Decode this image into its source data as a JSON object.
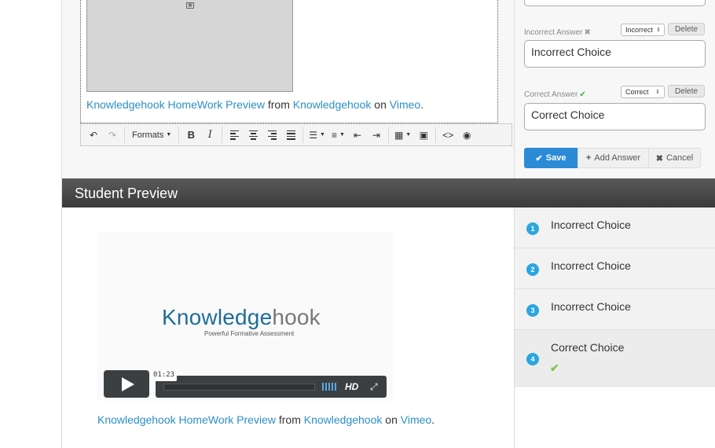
{
  "editor": {
    "placeholder_icon": "video-placeholder-icon",
    "credit": {
      "title": "Knowledgehook HomeWork Preview",
      "from": "from",
      "author": "Knowledgehook",
      "on": "on",
      "site": "Vimeo",
      "period": "."
    },
    "toolbar": {
      "undo": "↶",
      "redo": "↷",
      "formats": "Formats",
      "bold": "B",
      "italic": "I",
      "code": "<>",
      "preview": "◉"
    }
  },
  "answers": {
    "incorrect": {
      "label": "Incorrect Answer",
      "select": "Incorrect",
      "delete": "Delete",
      "value": "Incorrect Choice"
    },
    "correct": {
      "label": "Correct Answer",
      "select": "Correct",
      "delete": "Delete",
      "value": "Correct Choice"
    },
    "buttons": {
      "save": "Save",
      "add": "Add Answer",
      "cancel": "Cancel"
    }
  },
  "preview": {
    "header": "Student Preview",
    "video": {
      "brand_main": "Knowledge",
      "brand_light": "hook",
      "brand_sub": "Powerful Formative Assessment",
      "time": "01:23",
      "hd": "HD"
    },
    "credit": {
      "title": "Knowledgehook HomeWork Preview",
      "from": "from",
      "author": "Knowledgehook",
      "on": "on",
      "site": "Vimeo",
      "period": "."
    },
    "choices": [
      {
        "num": "1",
        "text": "Incorrect Choice"
      },
      {
        "num": "2",
        "text": "Incorrect Choice"
      },
      {
        "num": "3",
        "text": "Incorrect Choice"
      },
      {
        "num": "4",
        "text": "Correct Choice"
      }
    ]
  },
  "colors": {
    "accent": "#2b8bd6",
    "link": "#2a8fc8",
    "check": "#7ac943",
    "badge": "#2ba6de"
  }
}
